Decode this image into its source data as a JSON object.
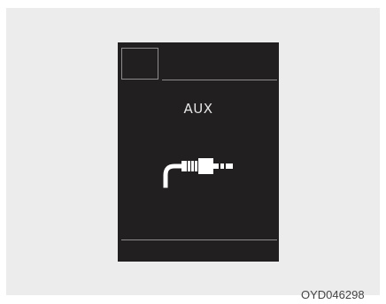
{
  "screen": {
    "source_label": "AUX",
    "icon": "aux-cable-icon"
  },
  "caption": "OYD046298",
  "colors": {
    "display_background": "#221f20",
    "display_text": "#e6e6e6",
    "divider": "#8e8c8c",
    "backdrop": "#ececec"
  }
}
